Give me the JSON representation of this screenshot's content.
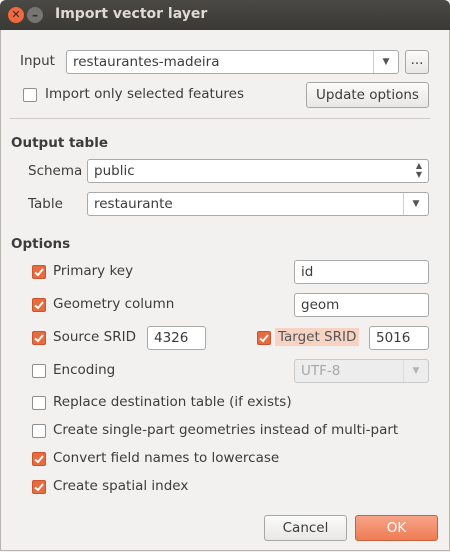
{
  "window": {
    "title": "Import vector layer"
  },
  "input": {
    "label": "Input",
    "value": "restaurantes-madeira",
    "browse_label": "...",
    "only_selected_label": "Import only selected features",
    "only_selected_checked": false,
    "update_label": "Update options"
  },
  "output_table": {
    "heading": "Output table",
    "schema_label": "Schema",
    "schema_value": "public",
    "table_label": "Table",
    "table_value": "restaurante"
  },
  "options": {
    "heading": "Options",
    "primary_key": {
      "label": "Primary key",
      "checked": true,
      "value": "id"
    },
    "geometry_column": {
      "label": "Geometry column",
      "checked": true,
      "value": "geom"
    },
    "source_srid": {
      "label": "Source SRID",
      "checked": true,
      "value": "4326"
    },
    "target_srid": {
      "label": "Target SRID",
      "checked": true,
      "value": "5016"
    },
    "encoding": {
      "label": "Encoding",
      "checked": false,
      "value": "UTF-8"
    },
    "replace_table": {
      "label": "Replace destination table (if exists)",
      "checked": false
    },
    "single_part": {
      "label": "Create single-part geometries instead of multi-part",
      "checked": false
    },
    "lowercase": {
      "label": "Convert field names to lowercase",
      "checked": true
    },
    "spatial_index": {
      "label": "Create spatial index",
      "checked": true
    }
  },
  "buttons": {
    "cancel": "Cancel",
    "ok": "OK"
  },
  "colors": {
    "accent": "#e86a3f",
    "titlebar": "#3c3b37"
  }
}
